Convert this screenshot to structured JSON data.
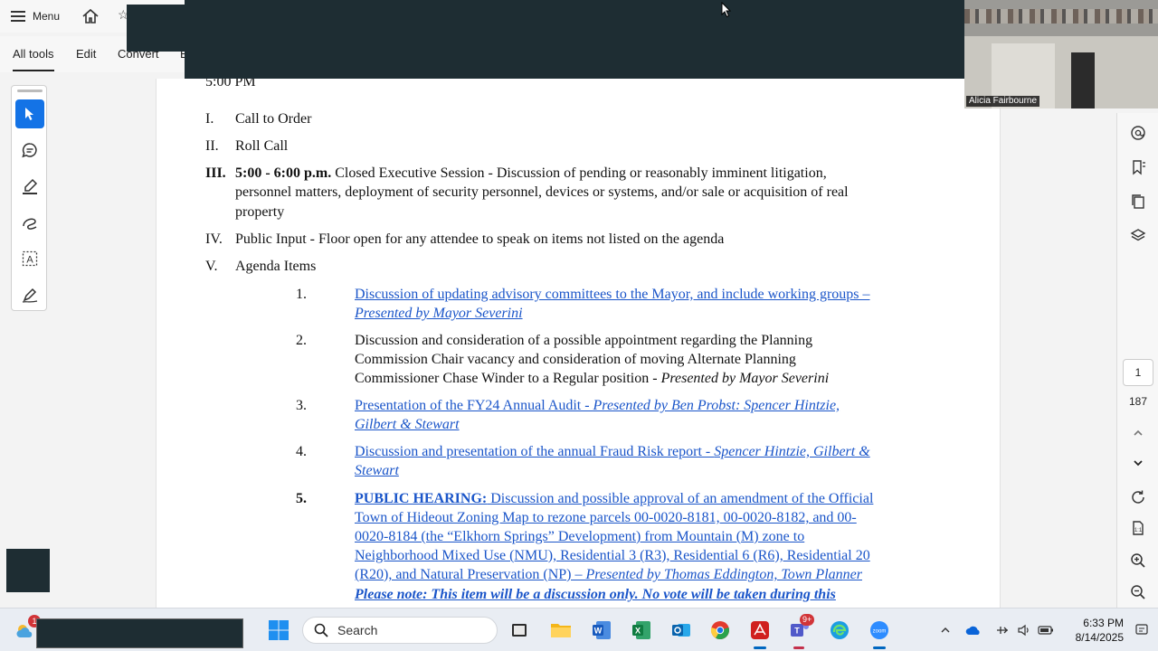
{
  "topbar": {
    "menu_label": "Menu"
  },
  "toolbar": {
    "tabs": [
      {
        "label": "All tools"
      },
      {
        "label": "Edit"
      },
      {
        "label": "Convert"
      },
      {
        "label": "E"
      }
    ]
  },
  "document": {
    "time_line": "5:00 PM",
    "outline": [
      {
        "num": "I.",
        "text": "Call to Order"
      },
      {
        "num": "II.",
        "text": "Roll Call"
      },
      {
        "num": "III.",
        "bold": "5:00 - 6:00 p.m.",
        "text1": " Closed Executive Session - Discussion of pending or reasonably imminent litigation,",
        "text2": "personnel matters, deployment of security personnel, devices or systems, and/or sale or acquisition of real",
        "text3": "property"
      },
      {
        "num": "IV.",
        "text": "Public Input - Floor open for any attendee to speak on items not listed on the agenda"
      },
      {
        "num": "V.",
        "text": "Agenda Items"
      }
    ],
    "agenda": [
      {
        "num": "1.",
        "line1": "Discussion of updating advisory committees to the Mayor, and include working groups –",
        "line2": "Presented by Mayor Severini"
      },
      {
        "num": "2.",
        "line1": "Discussion and consideration of a possible appointment regarding the Planning",
        "line2": "Commission Chair vacancy and consideration of moving Alternate Planning",
        "line3a": "Commissioner Chase Winder to a Regular position - ",
        "line3b": "Presented by Mayor Severini"
      },
      {
        "num": "3.",
        "line1a": "Presentation of the FY24 Annual Audit - ",
        "line1b": "Presented by Ben Probst: Spencer Hintzie,",
        "line2": "Gilbert & Stewart"
      },
      {
        "num": "4.",
        "line1a": "Discussion and presentation of the annual Fraud Risk report - ",
        "line1b": "Spencer Hintzie, Gilbert &",
        "line2": "Stewart"
      },
      {
        "num": "5.",
        "line1a": "PUBLIC HEARING:",
        "line1b": " Discussion and possible approval of an amendment of the Official",
        "line2": "Town of Hideout Zoning Map to rezone parcels 00-0020-8181, 00-0020-8182, and 00-",
        "line3": "0020-8184 (the “Elkhorn Springs” Development) from Mountain (M) zone to",
        "line4": "Neighborhood Mixed Use (NMU), Residential 3 (R3), Residential 6 (R6), Residential 20",
        "line5a": "(R20), and Natural Preservation (NP) – ",
        "line5b": "Presented by Thomas Eddington, Town Planner",
        "line6": "Please note: This item will be a discussion only. No vote will be taken during this"
      }
    ]
  },
  "page_nav": {
    "current_page": "1",
    "total_pages": "187"
  },
  "video": {
    "participant_name": "Alicia Fairbourne"
  },
  "taskbar": {
    "notification_badge": "1",
    "search_placeholder": "Search",
    "teams_badge": "9+",
    "time": "6:33 PM",
    "date": "8/14/2025"
  }
}
